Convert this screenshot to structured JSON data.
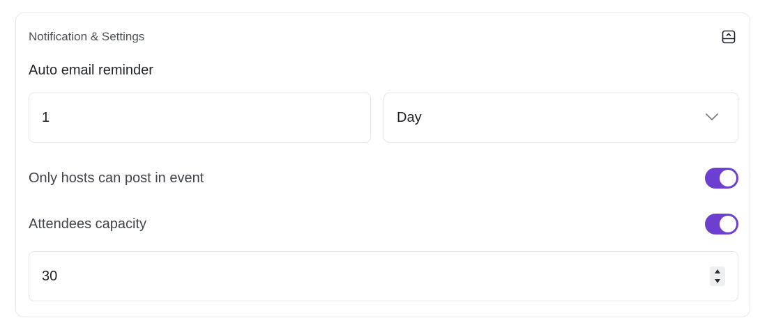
{
  "panel": {
    "title": "Notification & Settings",
    "collapse_icon": "collapse-panel-icon"
  },
  "auto_email_reminder": {
    "label": "Auto email reminder",
    "amount_value": "1",
    "unit_selected": "Day",
    "unit_dropdown_icon": "chevron-down-icon"
  },
  "only_hosts_can_post": {
    "label": "Only hosts can post in event",
    "enabled": true
  },
  "attendees_capacity": {
    "label": "Attendees capacity",
    "enabled": true,
    "value": "30",
    "spinner_icons": [
      "spin-up-icon",
      "spin-down-icon"
    ]
  },
  "colors": {
    "toggle_on": "#6c3fd0",
    "border": "#e3e5e9",
    "text_primary": "#1c1f24",
    "text_secondary": "#4b4f58"
  }
}
